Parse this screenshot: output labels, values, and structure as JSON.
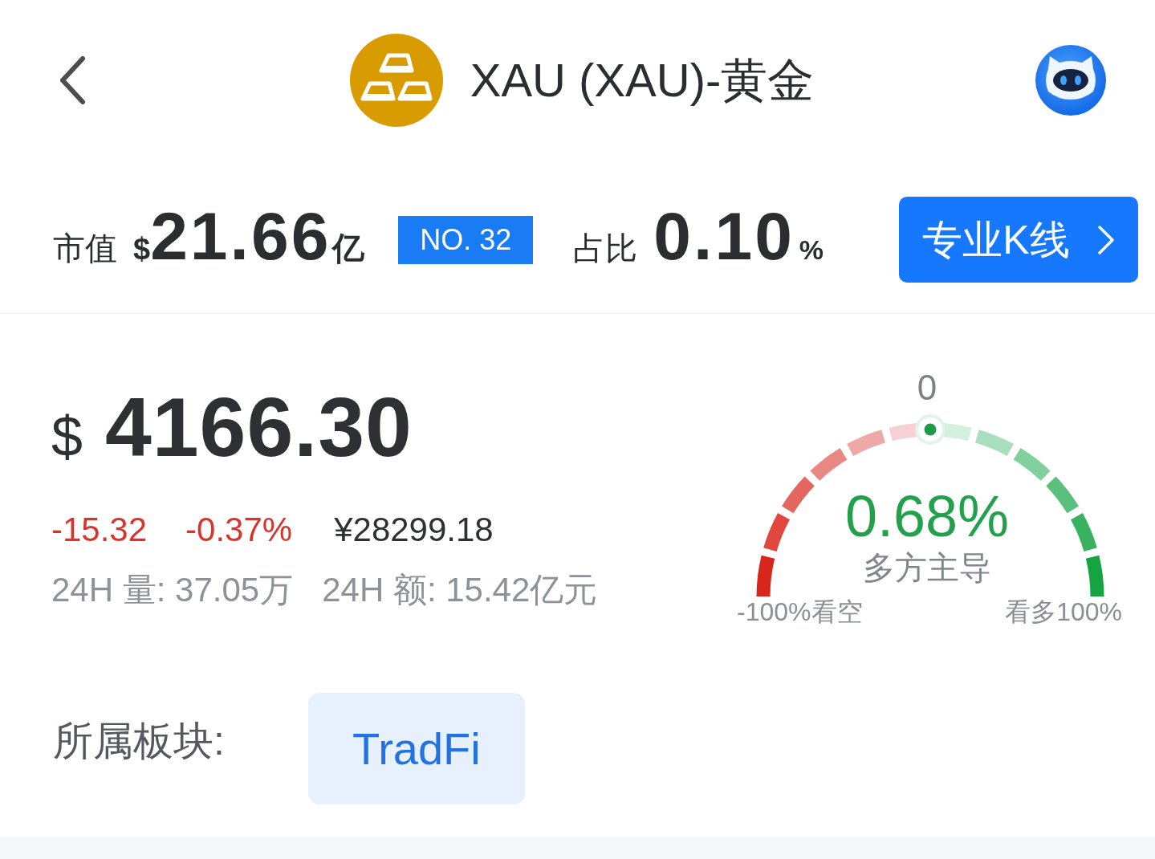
{
  "header": {
    "title": "XAU (XAU)-黄金"
  },
  "market_stats": {
    "cap": {
      "label": "市值",
      "currency": "$",
      "amount": "21.66",
      "unit": "亿"
    },
    "rank": "NO. 32",
    "share": {
      "label": "占比",
      "amount": "0.10",
      "unit": "%"
    },
    "kline_button": {
      "label": "专业K线"
    }
  },
  "price": {
    "currency": "$",
    "value": "4166.30",
    "change": "-15.32",
    "change_percent": "-0.37%",
    "cny": "¥28299.18",
    "volume_24h": "24H 量: 37.05万",
    "turnover_24h": "24H 额: 15.42亿元"
  },
  "sentiment_gauge": {
    "center_tick": "0",
    "value": "0.68%",
    "verdict": "多方主导",
    "min_label": "-100%看空",
    "max_label": "看多100%"
  },
  "sector": {
    "label": "所属板块:",
    "tags": [
      {
        "label": "TradFi"
      }
    ]
  }
}
